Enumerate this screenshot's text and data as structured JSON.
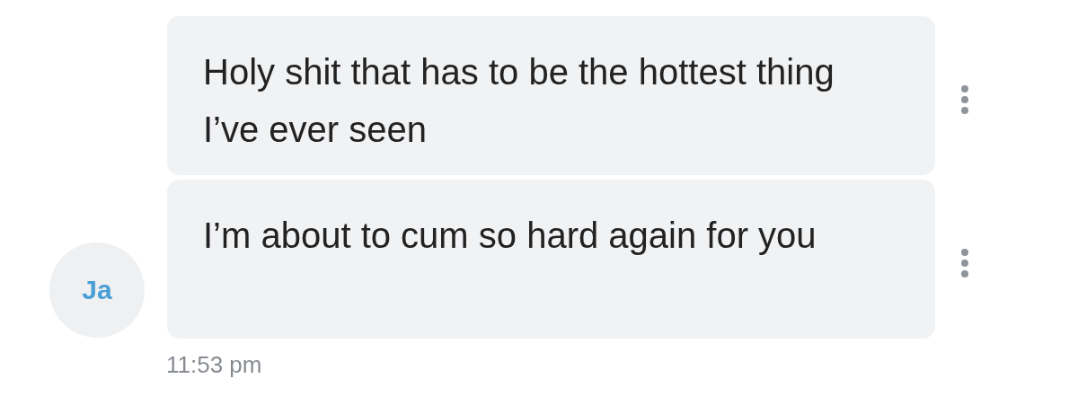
{
  "sender": {
    "initials": "Ja"
  },
  "messages": [
    {
      "text": "Holy shit that has to be the hottest thing I’ve ever seen"
    },
    {
      "text": "I’m about to cum so hard again for you"
    }
  ],
  "timestamp": "11:53 pm"
}
